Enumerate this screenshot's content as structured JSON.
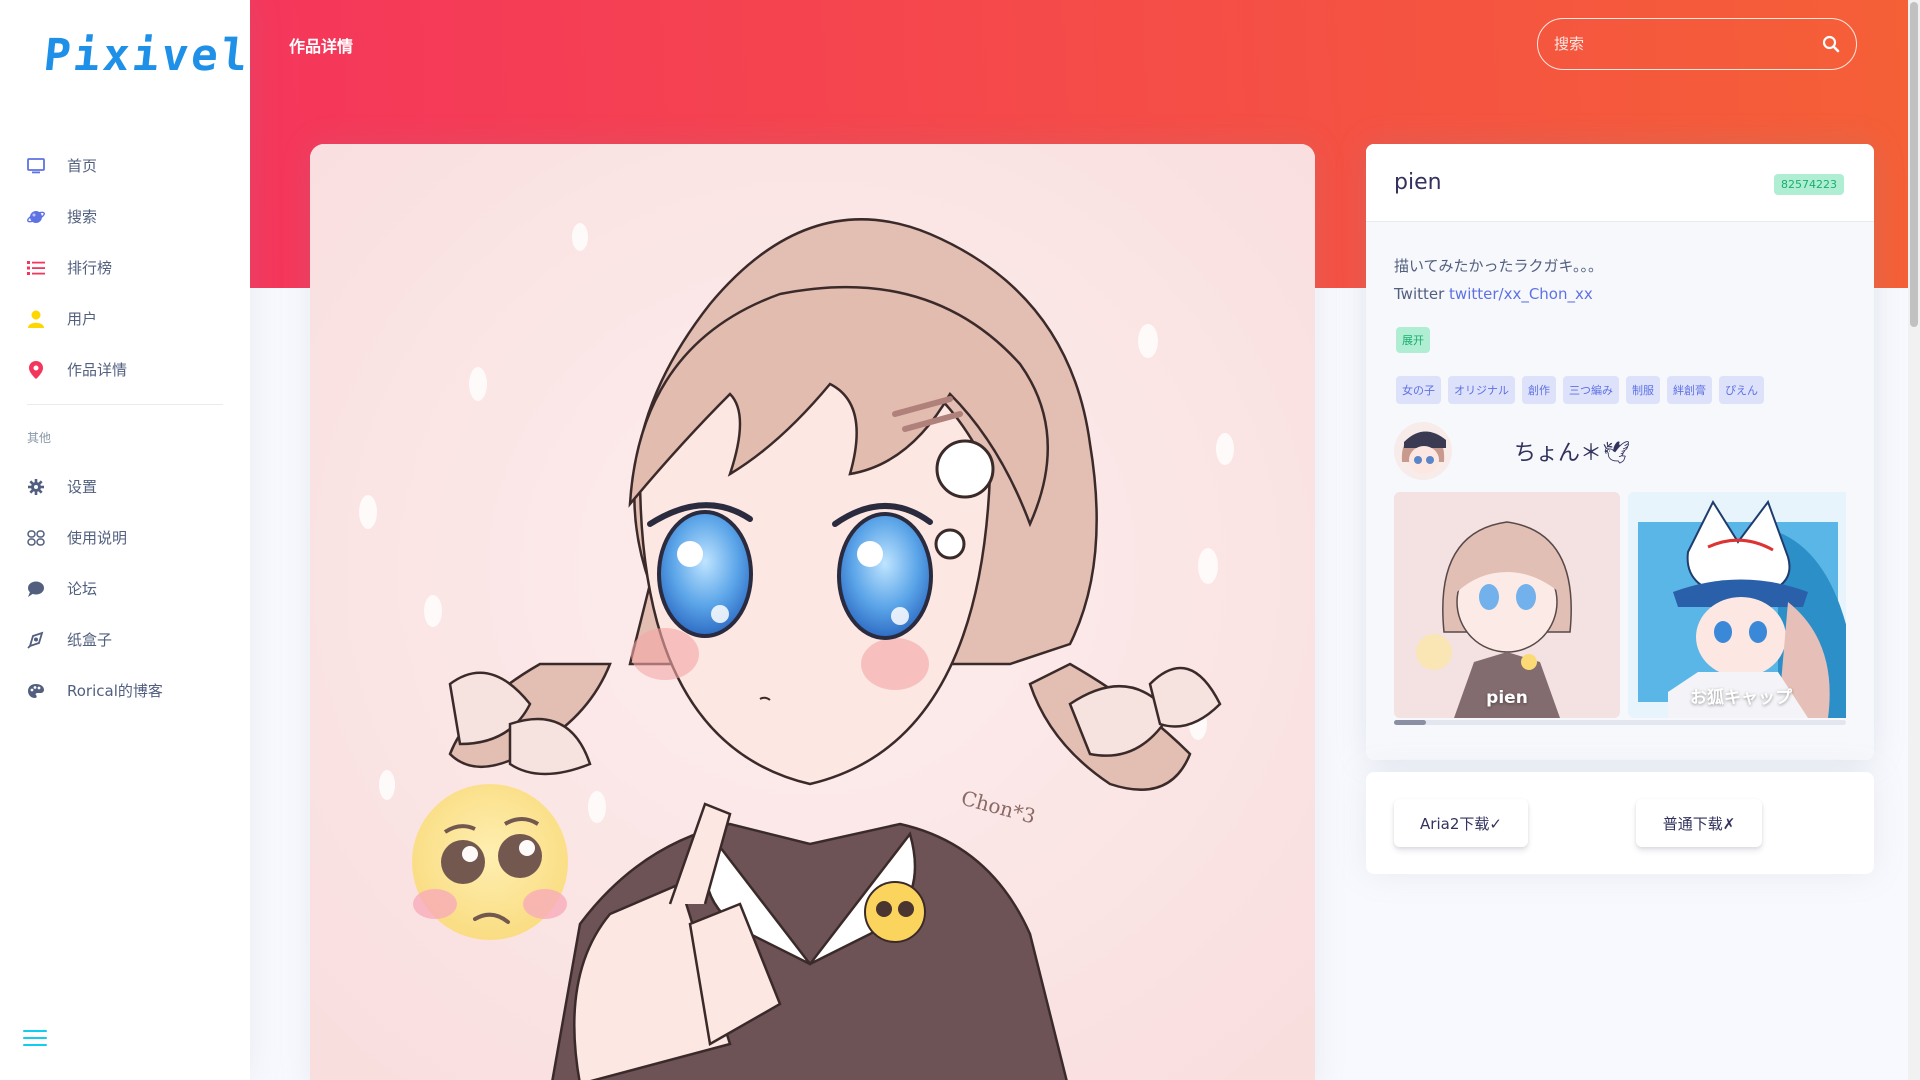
{
  "app": {
    "logo": "Pixivel"
  },
  "sidebar": {
    "items": [
      {
        "label": "首页",
        "icon": "monitor-icon"
      },
      {
        "label": "搜索",
        "icon": "planet-icon"
      },
      {
        "label": "排行榜",
        "icon": "list-icon"
      },
      {
        "label": "用户",
        "icon": "user-icon"
      },
      {
        "label": "作品详情",
        "icon": "pin-icon"
      }
    ],
    "section_title": "其他",
    "other_items": [
      {
        "label": "设置",
        "icon": "gear-icon"
      },
      {
        "label": "使用说明",
        "icon": "book-icon"
      },
      {
        "label": "论坛",
        "icon": "chat-icon"
      },
      {
        "label": "纸盒子",
        "icon": "box-icon"
      },
      {
        "label": "Rorical的博客",
        "icon": "palette-icon"
      }
    ]
  },
  "header": {
    "title": "作品详情",
    "search_placeholder": "搜索"
  },
  "artwork": {
    "title": "pien",
    "id": "82574223",
    "description_line1": "描いてみたかったラクガキ。。。",
    "description_prefix": "Twitter ",
    "description_link": "twitter/xx_Chon_xx",
    "expand_label": "展开",
    "tags": [
      "女の子",
      "オリジナル",
      "創作",
      "三つ編み",
      "制服",
      "絆創膏",
      "ぴえん"
    ],
    "author_name": "ちょん＊🕊",
    "related": [
      {
        "caption": "pien"
      },
      {
        "caption": "お狐キャップ"
      }
    ],
    "related_scroll_progress": 0.07
  },
  "download": {
    "aria2_label": "Aria2下载✓",
    "normal_label": "普通下载✗"
  },
  "colors": {
    "header_gradient_start": "#f5365c",
    "header_gradient_end": "#f56036",
    "primary": "#5e72e4",
    "success": "#1aae6f",
    "logo": "#1e90e8"
  }
}
